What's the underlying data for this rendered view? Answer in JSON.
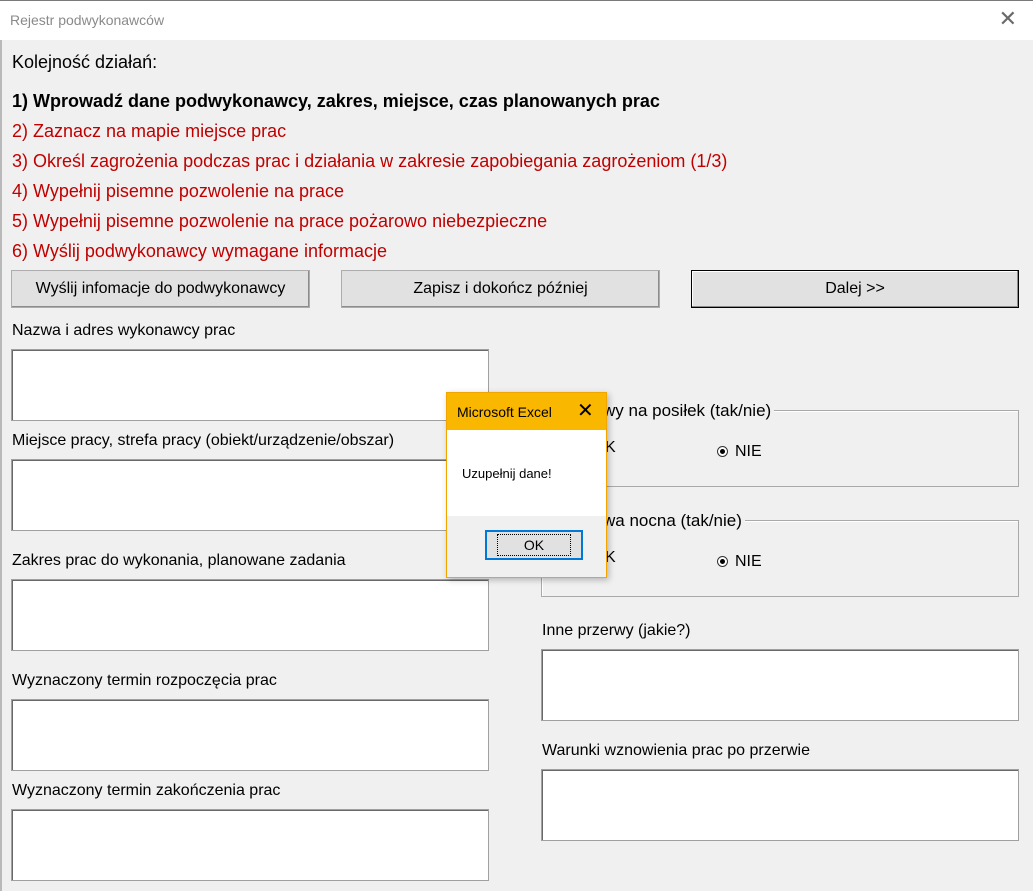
{
  "window": {
    "title": "Rejestr podwykonawców",
    "close_glyph": "✕"
  },
  "sequence": {
    "label": "Kolejność działań:",
    "steps": [
      "1) Wprowadź dane podwykonawcy, zakres, miejsce, czas planowanych prac",
      "2) Zaznacz na mapie miejsce prac",
      "3) Określ zagrożenia podczas prac i działania w zakresie zapobiegania zagrożeniom (1/3)",
      "4) Wypełnij pisemne pozwolenie na prace",
      "5) Wypełnij pisemne pozwolenie na prace pożarowo niebezpieczne",
      "6) Wyślij podwykonawcy wymagane informacje"
    ]
  },
  "buttons": {
    "send": "Wyślij infomacje do podwykonawcy",
    "save": "Zapisz i dokończ później",
    "next": "Dalej >>"
  },
  "fields": {
    "contractor": {
      "label": "Nazwa i adres wykonawcy prac",
      "value": ""
    },
    "location": {
      "label": "Miejsce pracy, strefa pracy (obiekt/urządzenie/obszar)",
      "value": ""
    },
    "scope": {
      "label": "Zakres  prac do wykonania, planowane zadania",
      "value": ""
    },
    "start": {
      "label": "Wyznaczony termin rozpoczęcia prac",
      "value": ""
    },
    "end": {
      "label": "Wyznaczony termin zakończenia prac",
      "value": ""
    },
    "other_breaks": {
      "label": "Inne przerwy (jakie?)",
      "value": ""
    },
    "resume_conditions": {
      "label": "Warunki wznowienia prac po przerwie",
      "value": ""
    }
  },
  "meal_break": {
    "caption_visible": "wy na posiłek (tak/nie)",
    "option_yes_visible": "K",
    "option_no": "NIE",
    "selected": "NIE"
  },
  "night_break": {
    "caption_visible": "wa nocna (tak/nie)",
    "option_yes_visible": "K",
    "option_no": "NIE",
    "selected": "NIE"
  },
  "dialog": {
    "title": "Microsoft Excel",
    "close_glyph": "✕",
    "message": "Uzupełnij dane!",
    "ok_label": "OK"
  },
  "colors": {
    "pending_step": "#c00000",
    "dialog_title_bg": "#f9b700",
    "ok_focus_border": "#0078d7"
  }
}
